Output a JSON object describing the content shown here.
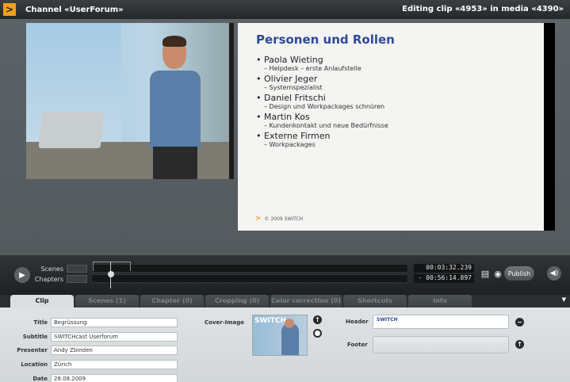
{
  "titlebar": {
    "logo_icon": "switch-logo-icon",
    "channel": "Channel «UserForum»",
    "editing": "Editing clip «4953» in media «4390»"
  },
  "slide": {
    "title": "Personen und Rollen",
    "items": [
      {
        "name": "Paola Wieting",
        "role": "Helpdesk – erste Anlaufstelle"
      },
      {
        "name": "Olivier Jeger",
        "role": "Systemspezialist"
      },
      {
        "name": "Daniel Fritschi",
        "role": "Design und Workpackages schnüren"
      },
      {
        "name": "Martin Kos",
        "role": "Kundenkontakt und neue Bedürfnisse"
      },
      {
        "name": "Externe Firmen",
        "role": "Workpackages"
      }
    ],
    "footer": "© 2009 SWITCH"
  },
  "controls": {
    "scenes_label": "Scenes",
    "chapters_label": "Chapters",
    "current_time": "00:03:32.239",
    "total_time": "- 00:56:14.897",
    "publish_label": "Publish"
  },
  "tabs": [
    {
      "label": "Clip",
      "active": true
    },
    {
      "label": "Scenes (1)",
      "active": false
    },
    {
      "label": "Chapter (0)",
      "active": false
    },
    {
      "label": "Cropping (0)",
      "active": false
    },
    {
      "label": "Color correction (0)",
      "active": false
    },
    {
      "label": "Shortcuts",
      "active": false
    },
    {
      "label": "Info",
      "active": false
    }
  ],
  "clip_form": {
    "title_label": "Title",
    "title_value": "Begrüssung",
    "subtitle_label": "Subtitle",
    "subtitle_value": "SWITCHcast Userforum",
    "presenter_label": "Presenter",
    "presenter_value": "Andy Zbinden",
    "location_label": "Location",
    "location_value": "Zürich",
    "date_label": "Date",
    "date_value": "28.08.2009",
    "cover_label": "Cover-Image",
    "header_label": "Header",
    "header_logo": "SWITCH",
    "footer_label": "Footer"
  }
}
